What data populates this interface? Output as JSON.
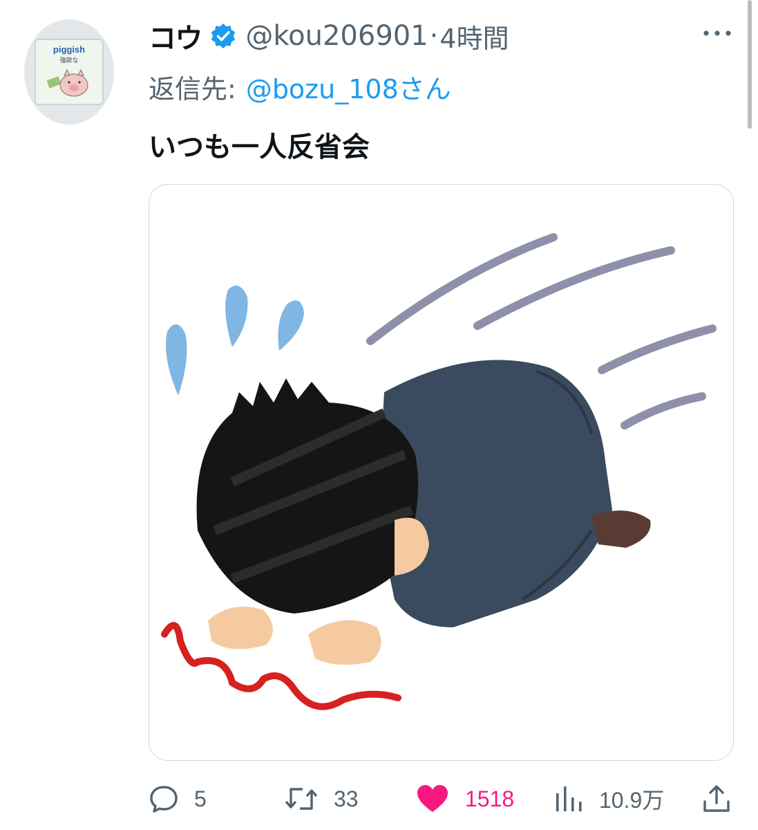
{
  "tweet": {
    "avatar": {
      "text": "piggish",
      "sub": "強欲な"
    },
    "display_name": "コウ",
    "verified_icon": "verified-badge-icon",
    "handle": "@kou206901",
    "separator": "·",
    "time": "4時間",
    "reply_label": "返信先:",
    "reply_target": "@bozu_108さん",
    "text": "いつも一人反省会",
    "media_alt": "dogeza-illustration"
  },
  "actions": {
    "reply_count": "5",
    "retweet_count": "33",
    "like_count": "1518",
    "views_count": "10.9万"
  },
  "colors": {
    "primary_text": "#0f1419",
    "secondary_text": "#536471",
    "link": "#1d9bf0",
    "like": "#f91880",
    "verified": "#1d9bf0"
  }
}
